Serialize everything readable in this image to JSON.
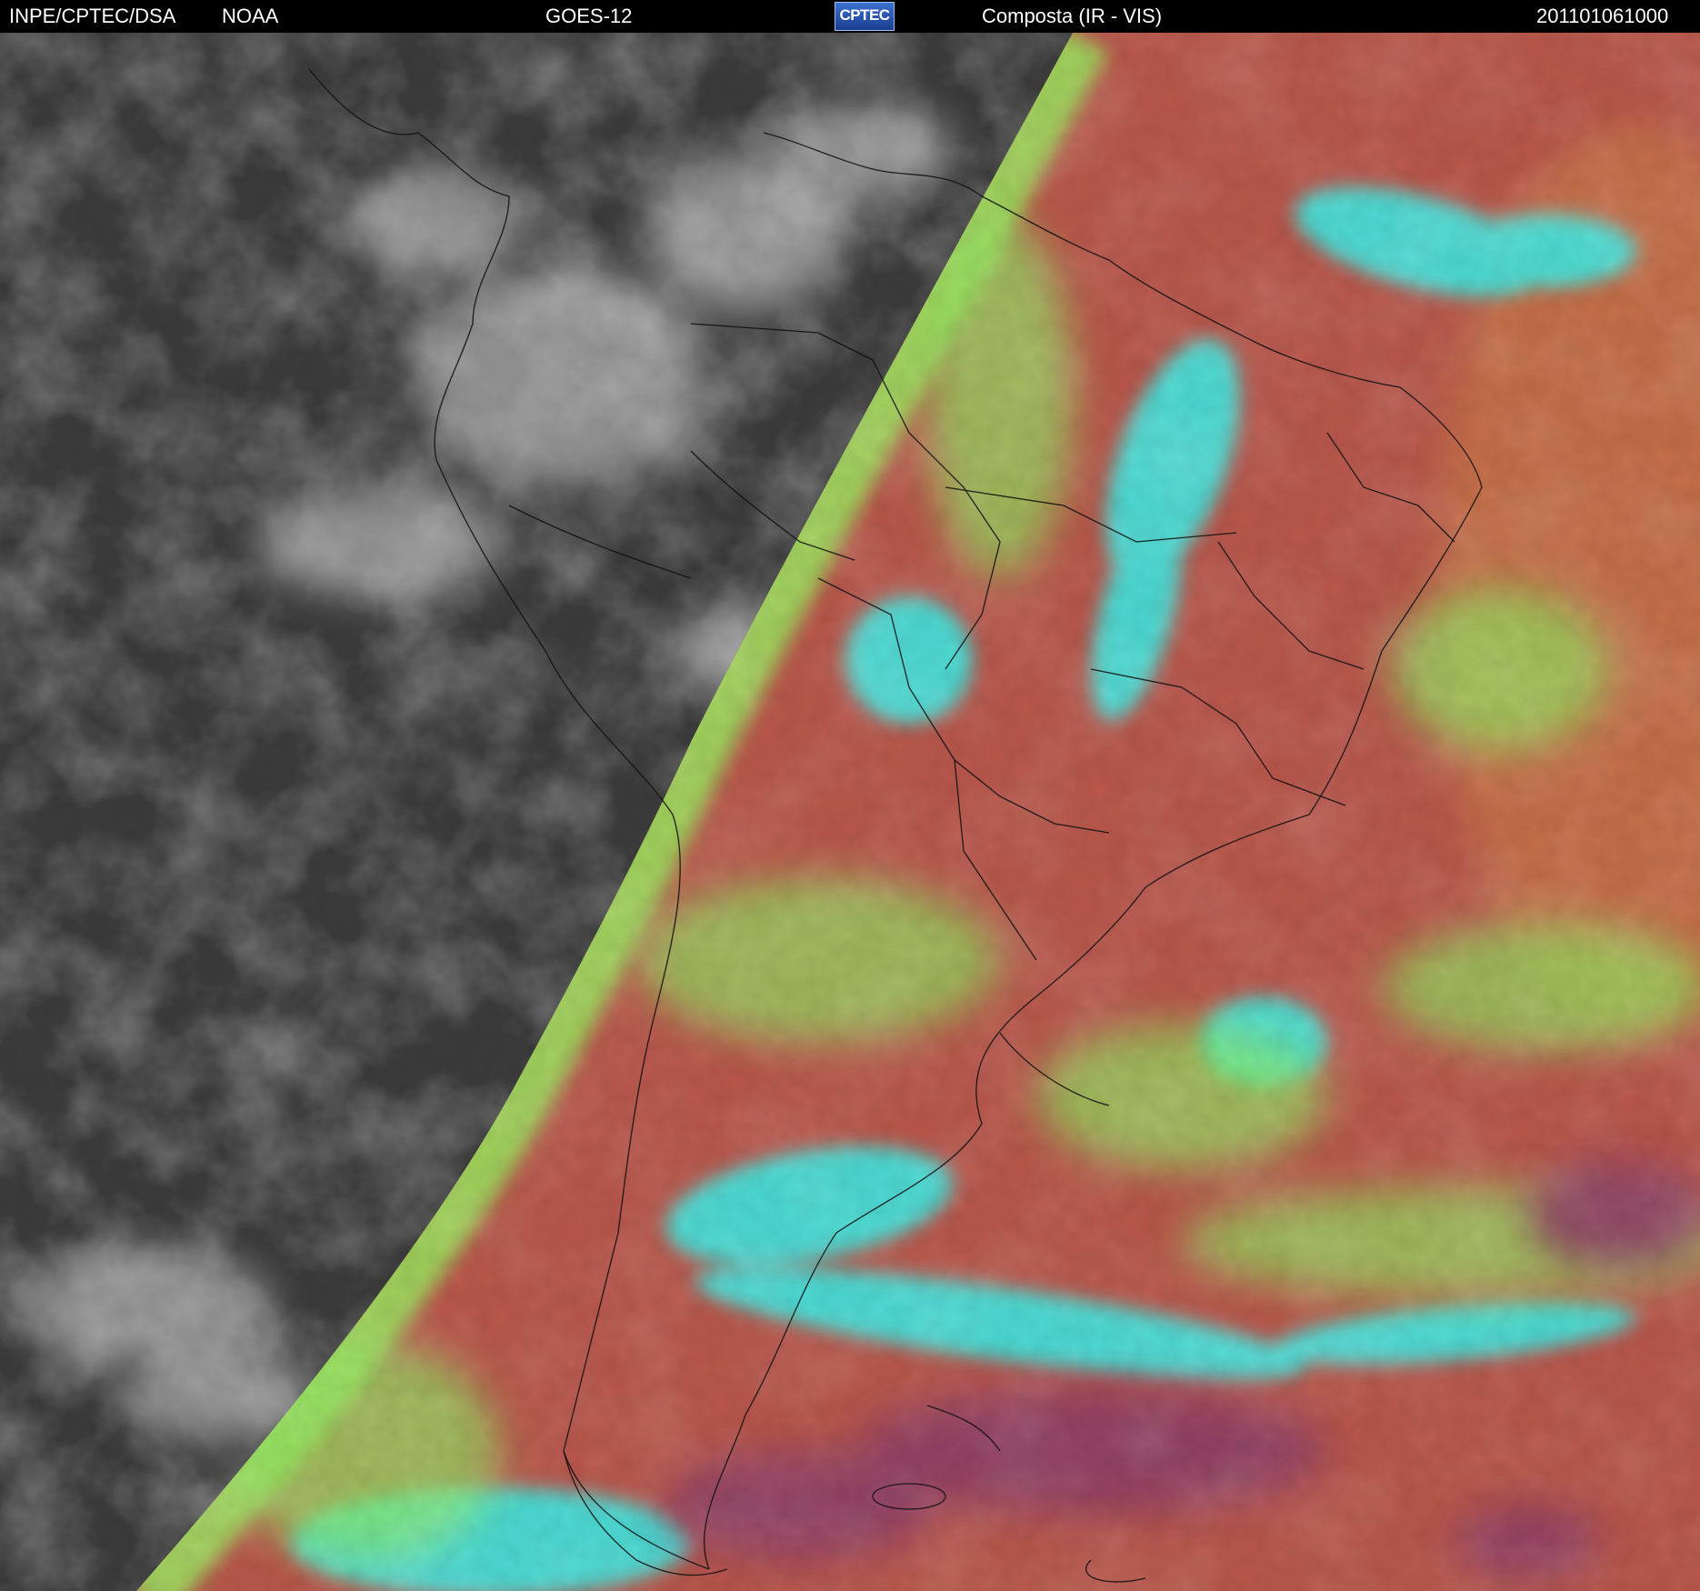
{
  "header": {
    "source": "INPE/CPTEC/DSA",
    "agency": "NOAA",
    "satellite": "GOES-12",
    "logo_text": "CPTEC",
    "product": "Composta (IR - VIS)",
    "timestamp": "201101061000"
  },
  "image": {
    "night_color": "#3b3b3b",
    "day_base_color": "#b8574c",
    "cloud_cyan": "#3fe6e0",
    "cloud_green": "#8fe862",
    "cloud_purple": "#8e3f66",
    "border_color": "#111111"
  }
}
